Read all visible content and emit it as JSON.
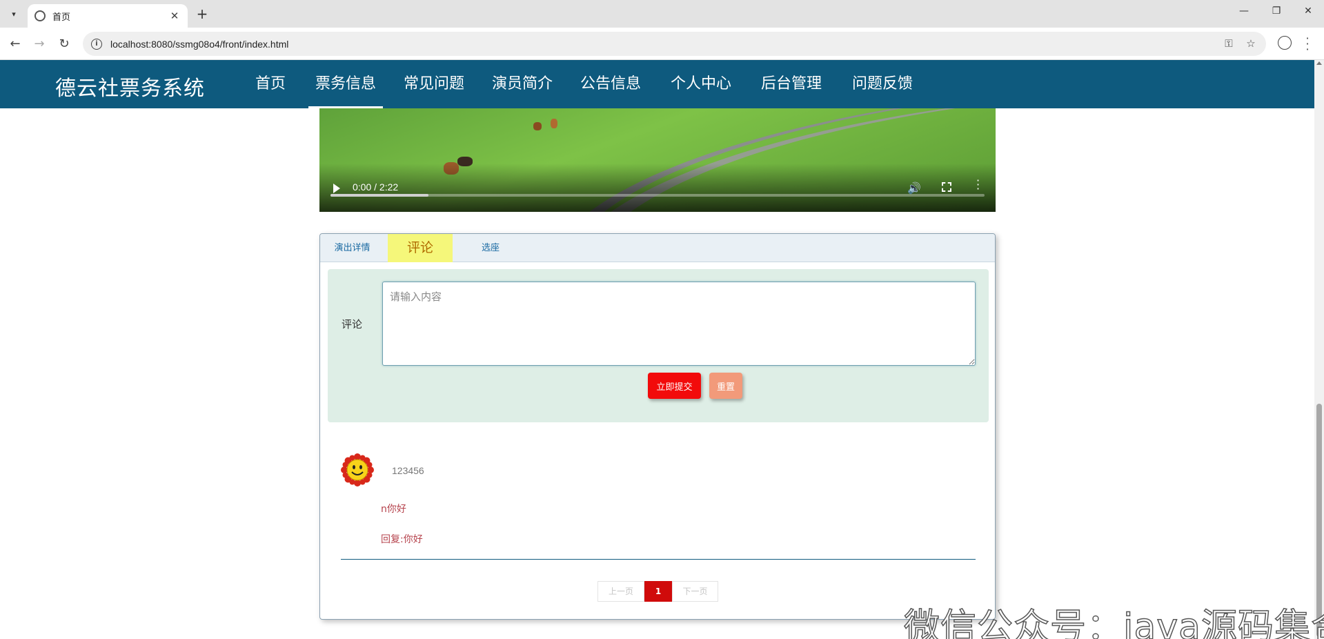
{
  "browser": {
    "tab_title": "首页",
    "url": "localhost:8080/ssmg08o4/front/index.html"
  },
  "site": {
    "brand": "德云社票务系统",
    "nav": [
      "首页",
      "票务信息",
      "常见问题",
      "演员简介",
      "公告信息",
      "个人中心",
      "后台管理",
      "问题反馈"
    ],
    "active_nav": "票务信息"
  },
  "video": {
    "time": "0:00 / 2:22",
    "buffered_fraction": 0.15
  },
  "tabs": {
    "items": [
      "演出详情",
      "评论",
      "选座"
    ],
    "active": "评论"
  },
  "comment_form": {
    "label": "评论",
    "placeholder": "请输入内容",
    "value": "",
    "submit": "立即提交",
    "reset": "重置"
  },
  "comments": [
    {
      "user": "123456",
      "avatar_icon": "sunflower-smiley-icon",
      "text": "n你好",
      "reply": "回复:你好"
    }
  ],
  "pagination": {
    "prev": "上一页",
    "current": "1",
    "next": "下一页"
  },
  "watermark": "微信公众号：java源码集合",
  "colors": {
    "header": "#0e5a7e",
    "active_tab": "#f5f77a",
    "submit": "#f20b0b",
    "reset": "#f29a7a",
    "page_current": "#d00b0b",
    "form_bg": "#deeee6"
  }
}
